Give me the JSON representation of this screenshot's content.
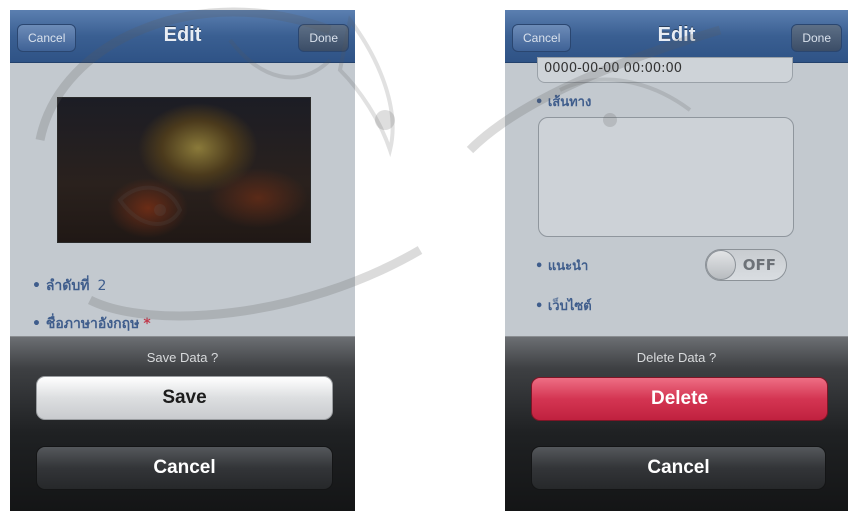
{
  "left_screen": {
    "navbar": {
      "title": "Edit",
      "cancel_label": "Cancel",
      "done_label": "Done"
    },
    "fields": {
      "order_label": "• ลำดับที่",
      "order_value": "2",
      "name_label": "• ชื่อภาษาอังกฤษ",
      "required_mark": "*"
    },
    "sheet": {
      "title": "Save Data ?",
      "primary_label": "Save",
      "cancel_label": "Cancel"
    }
  },
  "right_screen": {
    "navbar": {
      "title": "Edit",
      "cancel_label": "Cancel",
      "done_label": "Done"
    },
    "fields": {
      "date_value": "0000-00-00 00:00:00",
      "route_label": "• เส้นทาง",
      "recommend_label": "• แนะนำ",
      "toggle_state": "OFF",
      "website_label": "• เว็บไซต์"
    },
    "sheet": {
      "title": "Delete Data ?",
      "primary_label": "Delete",
      "cancel_label": "Cancel"
    }
  },
  "colors": {
    "navbar": "#3a5f92",
    "delete_button": "#d43552",
    "save_button": "#ffffff",
    "field_label": "#3f5d8c"
  }
}
